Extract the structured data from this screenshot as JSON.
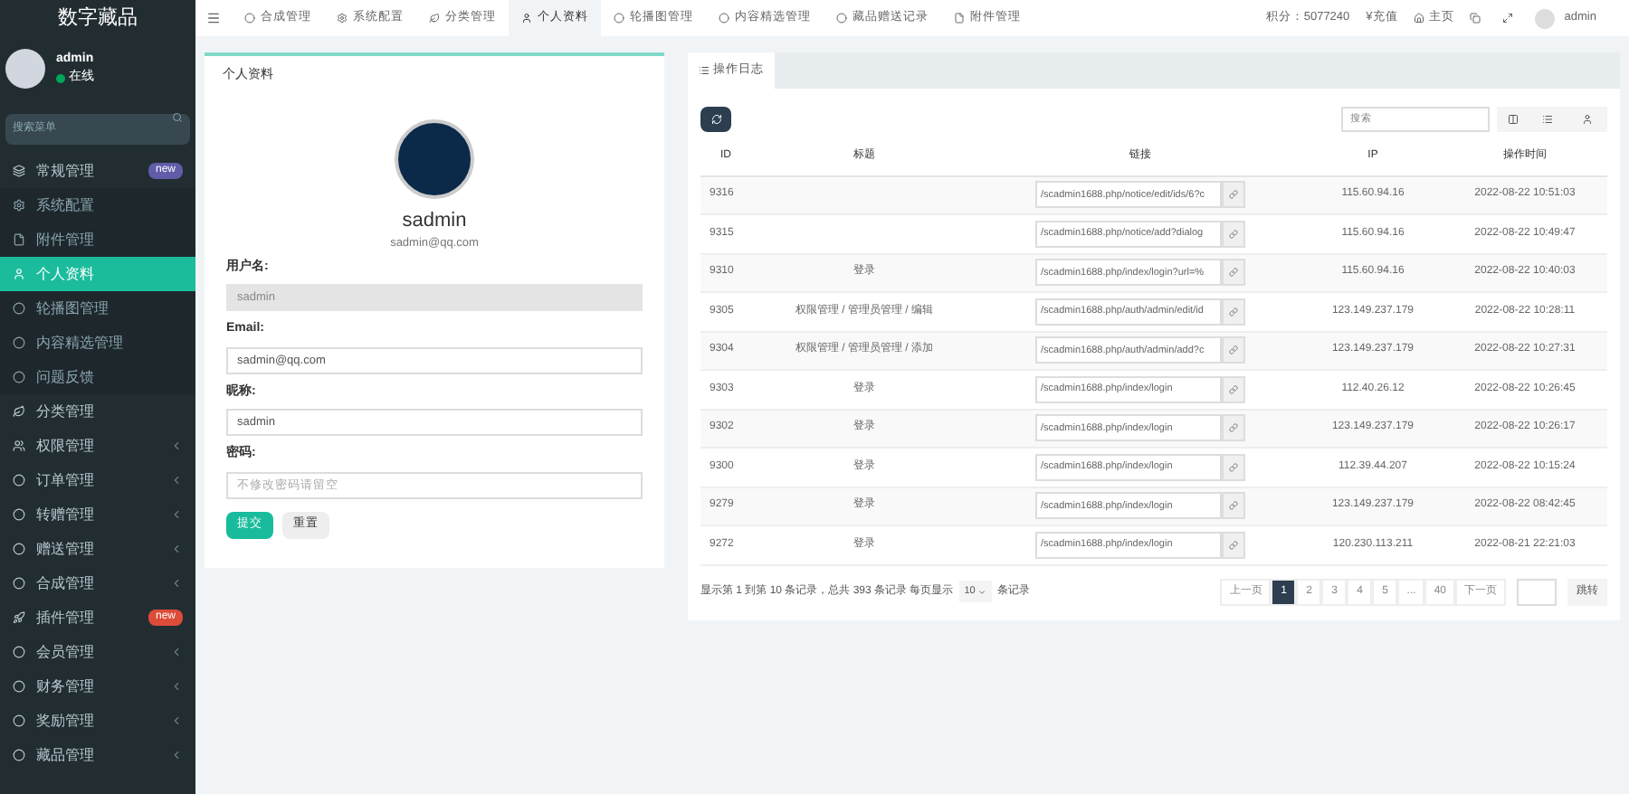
{
  "sidebar": {
    "logo": "数字藏品",
    "user": {
      "name": "admin",
      "status": "在线"
    },
    "search": {
      "placeholder": "搜索菜单"
    },
    "items": [
      {
        "label": "常规管理",
        "badge": "new",
        "color": "#605ca8",
        "expanded": true,
        "children": [
          {
            "label": "系统配置",
            "selected": false
          },
          {
            "label": "附件管理",
            "selected": false
          },
          {
            "label": "个人资料",
            "selected": true
          },
          {
            "label": "轮播图管理",
            "selected": false
          },
          {
            "label": "内容精选管理",
            "selected": false
          },
          {
            "label": "问题反馈",
            "selected": false
          }
        ]
      },
      {
        "label": "分类管理"
      },
      {
        "label": "权限管理",
        "expanded": false
      },
      {
        "label": "订单管理",
        "expanded": false
      },
      {
        "label": "转赠管理",
        "expanded": false
      },
      {
        "label": "赠送管理",
        "expanded": false
      },
      {
        "label": "合成管理",
        "expanded": false
      },
      {
        "label": "插件管理",
        "badge": "new",
        "color": "#dd4b39"
      },
      {
        "label": "会员管理",
        "expanded": false
      },
      {
        "label": "财务管理",
        "expanded": false
      },
      {
        "label": "奖励管理",
        "expanded": false
      },
      {
        "label": "藏品管理",
        "expanded": false
      }
    ]
  },
  "topbar": {
    "tabs": [
      {
        "label": "合成管理",
        "selected": false
      },
      {
        "label": "系统配置",
        "selected": false
      },
      {
        "label": "分类管理",
        "selected": false
      },
      {
        "label": "个人资料",
        "selected": true
      },
      {
        "label": "轮播图管理",
        "selected": false
      },
      {
        "label": "内容精选管理",
        "selected": false
      },
      {
        "label": "藏品赠送记录",
        "selected": false
      },
      {
        "label": "附件管理",
        "selected": false
      }
    ],
    "points": "积分：5077240",
    "recharge": "¥充值",
    "home": "主页",
    "user": "admin"
  },
  "profile": {
    "title": "个人资料",
    "name": "sadmin",
    "email": "sadmin@qq.com",
    "fields": [
      {
        "label": "用户名:",
        "value": "sadmin",
        "disabled": true
      },
      {
        "label": "Email:",
        "value": "sadmin@qq.com",
        "disabled": false
      },
      {
        "label": "昵称:",
        "value": "sadmin",
        "disabled": false
      },
      {
        "label": "密码:",
        "placeholder": "不修改密码请留空",
        "disabled": false
      }
    ],
    "buttons": [
      {
        "label": "提交",
        "kind": "primary"
      },
      {
        "label": "重置",
        "kind": "default"
      }
    ]
  },
  "log": {
    "tab": "操作日志",
    "search": {
      "placeholder": "搜索"
    },
    "table": {
      "columns": [
        "ID",
        "标题",
        "链接",
        "IP",
        "操作时间"
      ],
      "rows": [
        {
          "id": "9316",
          "title": "",
          "url": "/scadmin1688.php/notice/edit/ids/6?c",
          "ip": "115.60.94.16",
          "time": "2022-08-22 10:51:03"
        },
        {
          "id": "9315",
          "title": "",
          "url": "/scadmin1688.php/notice/add?dialog",
          "ip": "115.60.94.16",
          "time": "2022-08-22 10:49:47"
        },
        {
          "id": "9310",
          "title": "登录",
          "url": "/scadmin1688.php/index/login?url=%",
          "ip": "115.60.94.16",
          "time": "2022-08-22 10:40:03"
        },
        {
          "id": "9305",
          "title": "权限管理 / 管理员管理 / 编辑",
          "url": "/scadmin1688.php/auth/admin/edit/id",
          "ip": "123.149.237.179",
          "time": "2022-08-22 10:28:11"
        },
        {
          "id": "9304",
          "title": "权限管理 / 管理员管理 / 添加",
          "url": "/scadmin1688.php/auth/admin/add?c",
          "ip": "123.149.237.179",
          "time": "2022-08-22 10:27:31"
        },
        {
          "id": "9303",
          "title": "登录",
          "url": "/scadmin1688.php/index/login",
          "ip": "112.40.26.12",
          "time": "2022-08-22 10:26:45"
        },
        {
          "id": "9302",
          "title": "登录",
          "url": "/scadmin1688.php/index/login",
          "ip": "123.149.237.179",
          "time": "2022-08-22 10:26:17"
        },
        {
          "id": "9300",
          "title": "登录",
          "url": "/scadmin1688.php/index/login",
          "ip": "112.39.44.207",
          "time": "2022-08-22 10:15:24"
        },
        {
          "id": "9279",
          "title": "登录",
          "url": "/scadmin1688.php/index/login",
          "ip": "123.149.237.179",
          "time": "2022-08-22 08:42:45"
        },
        {
          "id": "9272",
          "title": "登录",
          "url": "/scadmin1688.php/index/login",
          "ip": "120.230.113.211",
          "time": "2022-08-21 22:21:03"
        }
      ]
    },
    "summary_before": "显示第 1 到第 10 条记录，总共 393 条记录 每页显示",
    "page_size": "10",
    "summary_after": "条记录",
    "pages": [
      {
        "label": "上一页",
        "selected": false
      },
      {
        "label": "1",
        "selected": true
      },
      {
        "label": "2",
        "selected": false
      },
      {
        "label": "3",
        "selected": false
      },
      {
        "label": "4",
        "selected": false
      },
      {
        "label": "5",
        "selected": false
      },
      {
        "label": "...",
        "selected": false
      },
      {
        "label": "40",
        "selected": false
      },
      {
        "label": "下一页",
        "selected": false
      }
    ],
    "jump": "跳转"
  }
}
